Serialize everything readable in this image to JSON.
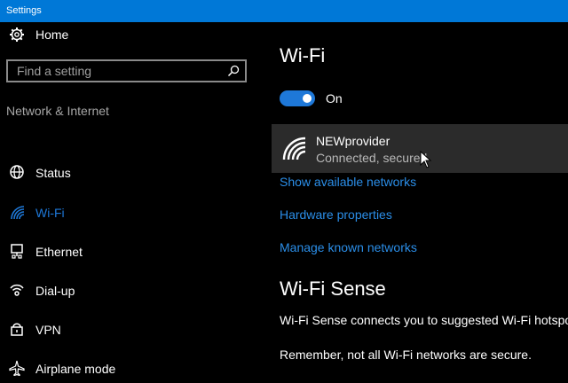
{
  "window": {
    "title": "Settings"
  },
  "sidebar": {
    "home_label": "Home",
    "search_placeholder": "Find a setting",
    "section_label": "Network & Internet",
    "items": [
      {
        "label": "Status",
        "icon": "globe-icon"
      },
      {
        "label": "Wi-Fi",
        "icon": "wifi-icon",
        "active": true
      },
      {
        "label": "Ethernet",
        "icon": "ethernet-icon"
      },
      {
        "label": "Dial-up",
        "icon": "dialup-icon"
      },
      {
        "label": "VPN",
        "icon": "vpn-icon"
      },
      {
        "label": "Airplane mode",
        "icon": "airplane-icon"
      }
    ]
  },
  "main": {
    "title": "Wi-Fi",
    "toggle_label": "On",
    "toggle_on": true,
    "network": {
      "name": "NEWprovider",
      "status": "Connected, secured"
    },
    "links": [
      "Show available networks",
      "Hardware properties",
      "Manage known networks"
    ],
    "section2_title": "Wi-Fi Sense",
    "para1": "Wi-Fi Sense connects you to suggested Wi-Fi hotspots",
    "para2": "Remember, not all Wi-Fi networks are secure."
  },
  "colors": {
    "accent": "#1e78d8",
    "titlebar": "#0078d7",
    "link": "#2b8ee8",
    "card": "#2b2b2b"
  }
}
